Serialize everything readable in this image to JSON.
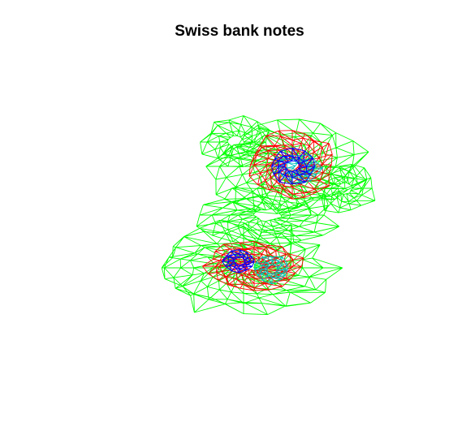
{
  "title": "Swiss bank notes",
  "chart_data": {
    "type": "3d-wireframe-contour",
    "title": "Swiss bank notes",
    "xlabel": "",
    "ylabel": "",
    "grid": false,
    "series": [
      {
        "color": "#00ff00"
      },
      {
        "color": "#ff0000"
      },
      {
        "color": "#0000ff"
      },
      {
        "color": "#00c0c0"
      }
    ]
  },
  "colors": {
    "background": "#ffffff",
    "title_text": "#000000"
  }
}
